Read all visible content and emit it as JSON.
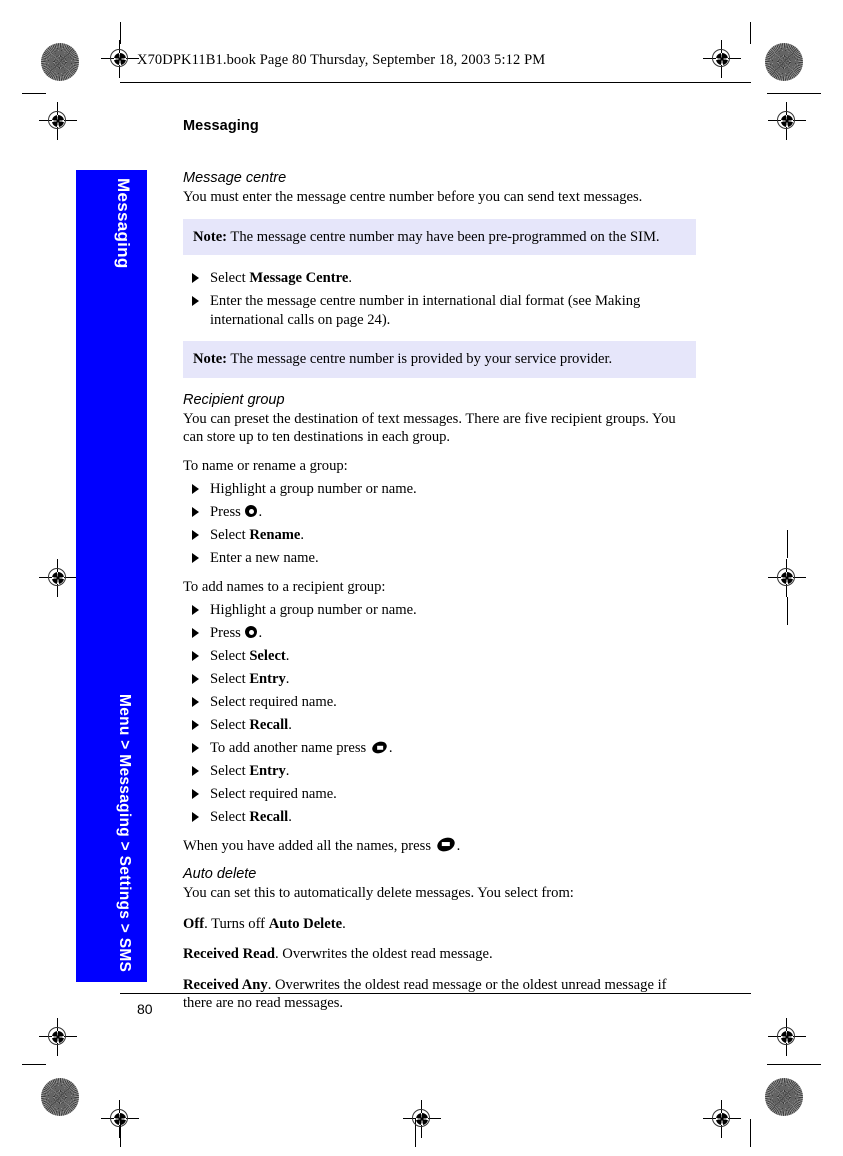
{
  "print_marks": {
    "slug_line": "X70DPK11B1.book  Page 80  Thursday, September 18, 2003  5:12 PM",
    "registration_icon": "registration-target-icon",
    "starburst_icon": "registration-starburst-icon"
  },
  "side_tab": {
    "background_color": "#0000FF",
    "text_color": "#FFFFFF",
    "chapter": "Messaging",
    "breadcrumb": "Menu > Messaging > Settings > SMS"
  },
  "page": {
    "chapter_title": "Messaging",
    "page_number": "80",
    "note_background_color": "#E6E6FA"
  },
  "sections": {
    "message_centre": {
      "heading": "Message centre",
      "intro": "You must enter the message centre number before you can send text messages.",
      "note1_label": "Note:",
      "note1_text": " The message centre number may have been pre-programmed on the SIM.",
      "steps": [
        {
          "pre": "Select ",
          "bold": "Message Centre",
          "post": "."
        },
        {
          "pre": "Enter the message centre number in international dial format (see Making international calls on page 24).",
          "bold": "",
          "post": ""
        }
      ],
      "note2_label": "Note:",
      "note2_text": " The message centre number is provided by your service provider."
    },
    "recipient_group": {
      "heading": "Recipient group",
      "intro": "You can preset the destination of text messages. There are five recipient groups. You can store up to ten destinations in each group.",
      "rename_lead": "To name or rename a group:",
      "rename_steps": [
        {
          "pre": "Highlight a group number or name.",
          "bold": "",
          "post": "",
          "icon": ""
        },
        {
          "pre": "Press ",
          "bold": "",
          "post": ".",
          "icon": "round-key-icon"
        },
        {
          "pre": "Select ",
          "bold": "Rename",
          "post": ".",
          "icon": ""
        },
        {
          "pre": "Enter a new name.",
          "bold": "",
          "post": "",
          "icon": ""
        }
      ],
      "add_lead": "To add names to a recipient group:",
      "add_steps": [
        {
          "pre": "Highlight a group number or name.",
          "bold": "",
          "post": "",
          "icon": ""
        },
        {
          "pre": "Press ",
          "bold": "",
          "post": ".",
          "icon": "round-key-icon"
        },
        {
          "pre": "Select ",
          "bold": "Select",
          "post": ".",
          "icon": ""
        },
        {
          "pre": "Select ",
          "bold": "Entry",
          "post": ".",
          "icon": ""
        },
        {
          "pre": "Select required name.",
          "bold": "",
          "post": "",
          "icon": ""
        },
        {
          "pre": "Select ",
          "bold": "Recall",
          "post": ".",
          "icon": ""
        },
        {
          "pre": "To add another name press ",
          "bold": "",
          "post": ".",
          "icon": "soft-key-icon"
        },
        {
          "pre": "Select ",
          "bold": "Entry",
          "post": ".",
          "icon": ""
        },
        {
          "pre": "Select required name.",
          "bold": "",
          "post": "",
          "icon": ""
        },
        {
          "pre": "Select ",
          "bold": "Recall",
          "post": ".",
          "icon": ""
        }
      ],
      "closing_pre": "When you have added all the names, press ",
      "closing_post": "."
    },
    "auto_delete": {
      "heading": "Auto delete",
      "intro": "You can set this to automatically delete messages. You select from:",
      "options": [
        {
          "bold": "Off",
          "mid": ". Turns off ",
          "bold2": "Auto Delete",
          "post": "."
        },
        {
          "bold": "Received Read",
          "mid": ". Overwrites the oldest read message.",
          "bold2": "",
          "post": ""
        },
        {
          "bold": "Received Any",
          "mid": ". Overwrites the oldest read message or the oldest unread message if there are no read messages.",
          "bold2": "",
          "post": ""
        }
      ]
    }
  }
}
